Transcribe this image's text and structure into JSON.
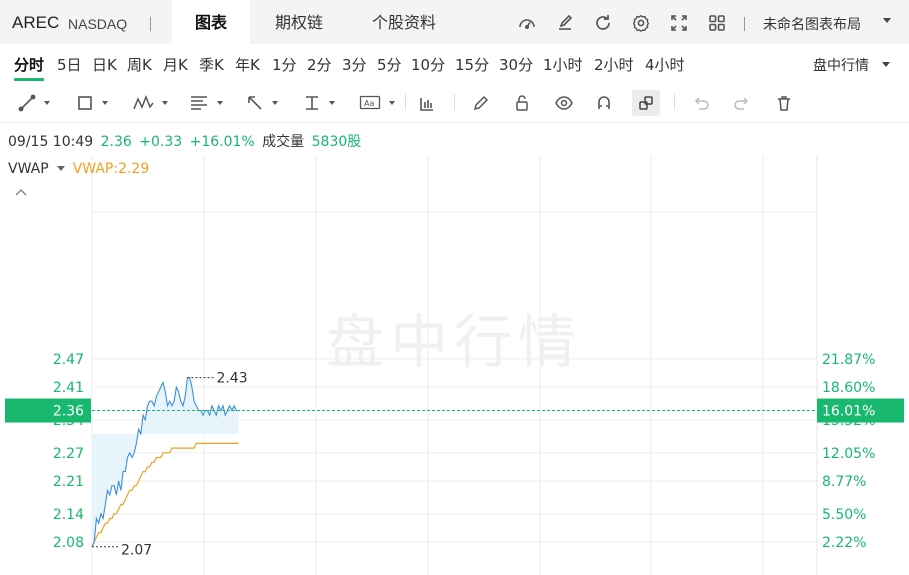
{
  "header": {
    "ticker": "AREC",
    "exchange": "NASDAQ",
    "tabs": [
      {
        "label": "图表",
        "active": true
      },
      {
        "label": "期权链",
        "active": false
      },
      {
        "label": "个股资料",
        "active": false
      }
    ],
    "icons": [
      "speedometer-icon",
      "edit-icon",
      "refresh-icon",
      "gear-icon",
      "fullscreen-icon",
      "grid-layout-icon"
    ],
    "layout_name": "未命名图表布局"
  },
  "periods": [
    "分时",
    "5日",
    "日K",
    "周K",
    "月K",
    "季K",
    "年K",
    "1分",
    "2分",
    "3分",
    "5分",
    "10分",
    "15分",
    "30分",
    "1小时",
    "2小时",
    "4小时"
  ],
  "active_period": "分时",
  "mode_select": "盘中行情",
  "drawing_tools": [
    "trendline-icon",
    "rectangle-icon",
    "pattern-icon",
    "fib-icon",
    "arrow-icon",
    "measure-icon",
    "text-annotation-icon",
    "indicator-icon",
    "pencil-icon",
    "lock-icon",
    "eye-icon",
    "magnet-icon",
    "link-icon",
    "undo-icon",
    "redo-icon",
    "trash-icon"
  ],
  "quote": {
    "datetime": "09/15 10:49",
    "price": "2.36",
    "change": "+0.33",
    "change_pct": "+16.01%",
    "volume_label": "成交量",
    "volume": "5830股"
  },
  "indicator": {
    "name": "VWAP",
    "value_text": "VWAP:2.29"
  },
  "watermark": "盘中行情",
  "colors": {
    "up": "#18b86f",
    "price_line": "#3d8fd9",
    "vwap_line": "#f0a020",
    "price_area": "#e3f1fb"
  },
  "chart_data": {
    "type": "line",
    "y_ticks": [
      2.47,
      2.41,
      2.34,
      2.27,
      2.21,
      2.14,
      2.08
    ],
    "y_tick_labels": [
      "2.47",
      "2.41",
      "2.34",
      "2.27",
      "2.21",
      "2.14",
      "2.08"
    ],
    "pct_tick_labels": [
      "21.87%",
      "18.60%",
      "15.32%",
      "12.05%",
      "8.77%",
      "5.50%",
      "2.22%"
    ],
    "current_price_label": "2.36",
    "current_pct_label": "16.01%",
    "high_label": "2.43",
    "low_label": "2.07",
    "high": 2.43,
    "low": 2.07,
    "series": [
      {
        "values": [
          2.07,
          2.08,
          2.13,
          2.12,
          2.14,
          2.13,
          2.16,
          2.19,
          2.18,
          2.2,
          2.2,
          2.18,
          2.21,
          2.19,
          2.23,
          2.23,
          2.26,
          2.27,
          2.26,
          2.27,
          2.29,
          2.32,
          2.31,
          2.35,
          2.34,
          2.37,
          2.38,
          2.38,
          2.37,
          2.39,
          2.4,
          2.41,
          2.42,
          2.4,
          2.37,
          2.38,
          2.37,
          2.38,
          2.41,
          2.4,
          2.38,
          2.37,
          2.39,
          2.43,
          2.43,
          2.41,
          2.38,
          2.37,
          2.36,
          2.36,
          2.35,
          2.36,
          2.36,
          2.35,
          2.37,
          2.36,
          2.35,
          2.37,
          2.36,
          2.37,
          2.35,
          2.36,
          2.37,
          2.36,
          2.37,
          2.36,
          2.36
        ]
      },
      {
        "values": [
          2.07,
          2.08,
          2.09,
          2.1,
          2.1,
          2.11,
          2.12,
          2.12,
          2.13,
          2.13,
          2.14,
          2.14,
          2.15,
          2.16,
          2.16,
          2.17,
          2.18,
          2.19,
          2.19,
          2.2,
          2.2,
          2.21,
          2.22,
          2.23,
          2.23,
          2.24,
          2.24,
          2.25,
          2.25,
          2.26,
          2.26,
          2.26,
          2.27,
          2.27,
          2.27,
          2.27,
          2.28,
          2.28,
          2.28,
          2.28,
          2.28,
          2.28,
          2.28,
          2.28,
          2.28,
          2.28,
          2.28,
          2.29,
          2.29,
          2.29,
          2.29,
          2.29,
          2.29,
          2.29,
          2.29,
          2.29,
          2.29,
          2.29,
          2.29,
          2.29,
          2.29,
          2.29,
          2.29,
          2.29,
          2.29,
          2.29,
          2.29
        ]
      }
    ]
  }
}
